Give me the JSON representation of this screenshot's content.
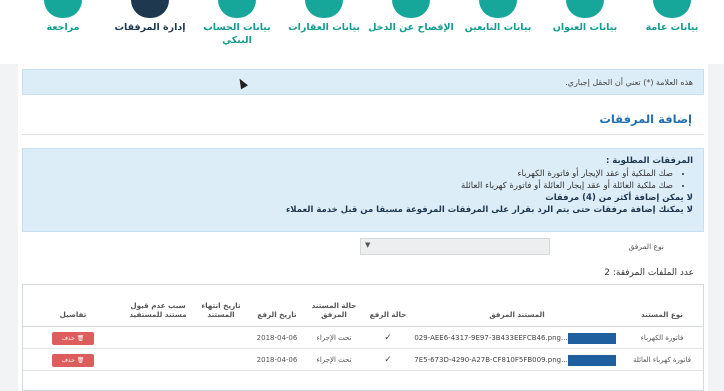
{
  "wizard": {
    "steps": [
      {
        "label": "مراجعة"
      },
      {
        "label": "إدارة المرفقات"
      },
      {
        "label": "بيانات الحساب البنكي"
      },
      {
        "label": "بيانات العقارات"
      },
      {
        "label": "الإفصاح عن الدخل"
      },
      {
        "label": "بيانات التابعين"
      },
      {
        "label": "بيانات العنوان"
      },
      {
        "label": "بيانات عامة"
      }
    ],
    "active_index": 1
  },
  "notice": {
    "text": "هذه العلامة (*) تعني أن الحقل إجباري."
  },
  "section": {
    "title": "إضافة المرفقات"
  },
  "info": {
    "heading": "المرفقات المطلوبة :",
    "items": [
      "صك الملكية أو عقد الإيجار أو فاتورة الكهرباء",
      "صك ملكية العائلة أو عقد إيجار العائلة أو فاتورة كهرباء العائلة"
    ],
    "limit_note": "لا يمكن إضافة أكثر من (4) مرفقات",
    "pending_note": "لا يمكنك إضافة مرفقات حتى يتم الرد بقرار على المرفقات المرفوعة مسبقا من قبل خدمة العملاء"
  },
  "form": {
    "type_label": "نوع المرفق"
  },
  "files": {
    "count_text": "عدد الملفات المرفقة: 2",
    "headers": {
      "doc_type": "نوع المستند",
      "attached_doc": "المستند المرفق",
      "upload_status": "حالة الرفع",
      "doc_status": "حالة المستند المرفق",
      "upload_date": "تاريخ الرفع",
      "expiry_date": "تاريخ انتهاء المستند",
      "reject_reason": "سبب عدم قبول مستند للمستفيد",
      "details": "تفاصيل"
    },
    "rows": [
      {
        "doc_type": "فاتورة الكهرباء",
        "file_name": "029-AEE6-4317-9E97-3B433EEFCB46.png...",
        "upload_status": "✓",
        "doc_status": "تحت الإجراء",
        "upload_date": "2018-04-06",
        "action": "حذف"
      },
      {
        "doc_type": "فاتورة كهرباء العائلة",
        "file_name": "7E5-673D-4290-A27B-CF810F5FB009.png...",
        "upload_status": "✓",
        "doc_status": "تحت الإجراء",
        "upload_date": "2018-04-06",
        "action": "حذف"
      }
    ]
  },
  "colors": {
    "accent": "#16a79a",
    "active_step": "#1e3850",
    "link_blue": "#1f6fb3",
    "info_bg": "#dcedf7",
    "delete_red": "#dd5c5c",
    "file_bar": "#1f5f9f"
  }
}
